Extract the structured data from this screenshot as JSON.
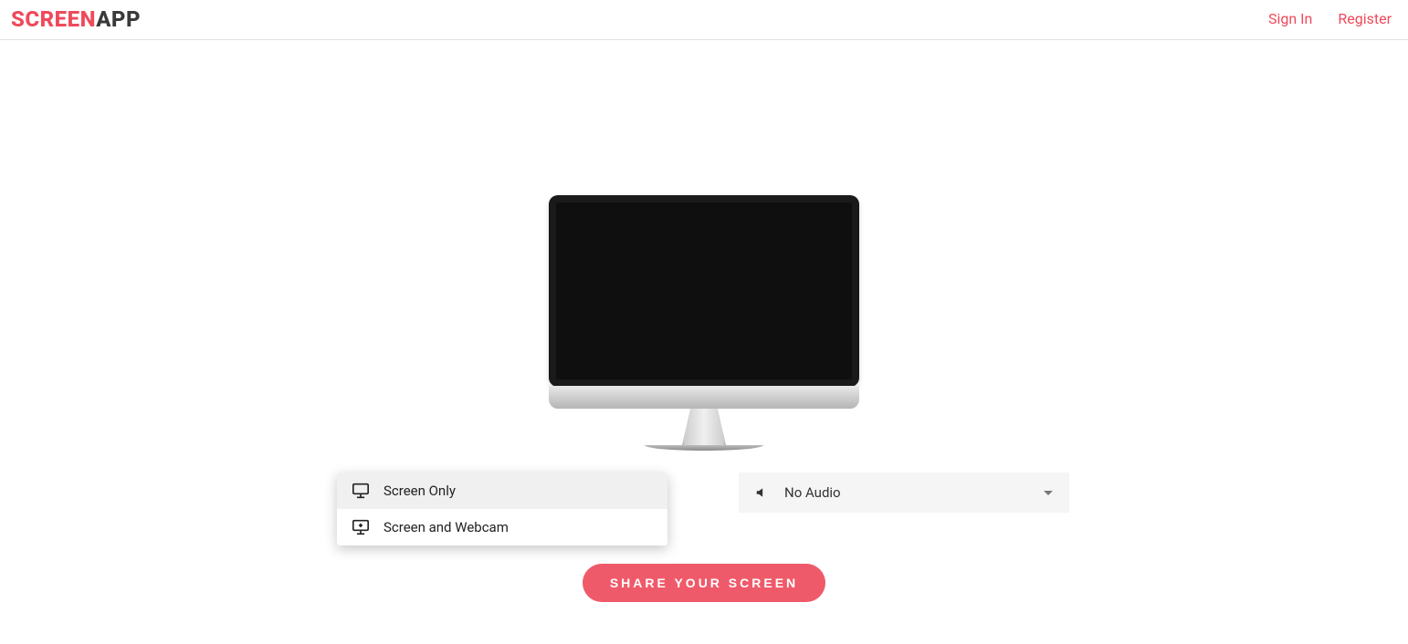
{
  "header": {
    "logo_part1": "SCREEN",
    "logo_part2": "APP",
    "nav": {
      "signin": "Sign In",
      "register": "Register"
    }
  },
  "video_source_menu": {
    "options": [
      {
        "label": "Screen Only"
      },
      {
        "label": "Screen and Webcam"
      }
    ]
  },
  "audio_dropdown": {
    "selected": "No Audio"
  },
  "share_button": {
    "label": "SHARE YOUR SCREEN"
  },
  "colors": {
    "accent": "#ef4a5b"
  }
}
